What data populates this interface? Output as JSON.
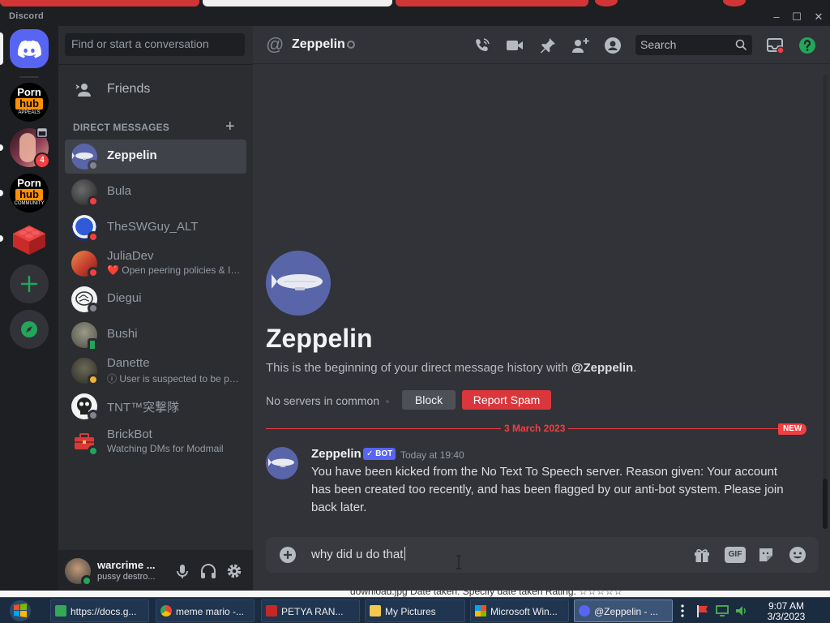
{
  "app": {
    "title": "Discord"
  },
  "window_controls": {
    "minimize": "–",
    "maximize": "☐",
    "close": "✕"
  },
  "servers": [
    {
      "name": "pornhub appeals",
      "logo_top": "Porn",
      "logo_bottom": "hub",
      "logo_sub": "APPEALS"
    },
    {
      "name": "server with notifications",
      "badge": "4"
    },
    {
      "name": "pornhub community",
      "logo_top": "Porn",
      "logo_bottom": "hub",
      "logo_sub": "COMMUNITY"
    },
    {
      "name": "lego server"
    }
  ],
  "sidebar": {
    "search_placeholder": "Find or start a conversation",
    "friends_label": "Friends",
    "dm_header": "DIRECT MESSAGES",
    "dm_add": "+",
    "dms": [
      {
        "name": "Zeppelin",
        "status": "offline",
        "active": true
      },
      {
        "name": "Bula",
        "status": "dnd"
      },
      {
        "name": "TheSWGuy_ALT",
        "status": "dnd"
      },
      {
        "name": "JuliaDev",
        "status": "dnd",
        "sub": "❤️ Open peering policies & IP..."
      },
      {
        "name": "Diegui",
        "status": "offline"
      },
      {
        "name": "Bushi",
        "status": "mobile"
      },
      {
        "name": "Danette",
        "status": "idle",
        "sub": "ⓘ User is suspected to be par..."
      },
      {
        "name": "TNT™突撃隊",
        "status": "offline"
      },
      {
        "name": "BrickBot",
        "status": "online",
        "sub": "Watching DMs for Modmail"
      }
    ]
  },
  "user_panel": {
    "name": "warcrime ...",
    "status": "pussy destro..."
  },
  "header": {
    "at": "@",
    "title": "Zeppelin",
    "search_placeholder": "Search"
  },
  "intro": {
    "name": "Zeppelin",
    "text_prefix": "This is the beginning of your direct message history with ",
    "text_handle": "@Zeppelin",
    "text_suffix": ".",
    "no_servers": "No servers in common",
    "block_label": "Block",
    "report_label": "Report Spam"
  },
  "divider": {
    "date": "3 March 2023",
    "new_label": "NEW"
  },
  "message": {
    "author": "Zeppelin",
    "bot_tag": "✓ BOT",
    "time": "Today at 19:40",
    "text": "You have been kicked from the No Text To Speech server. Reason given: Your account has been created too recently, and has been flagged by our anti-bot system. Please join back later."
  },
  "composer": {
    "value": "why did u do that",
    "gif_label": "GIF"
  },
  "behind_window": {
    "text": "download.jpg  Date taken: Specify date taken         Rating: ☆☆☆☆☆"
  },
  "taskbar": {
    "items": [
      {
        "label": "https://docs.g...",
        "color": "#34a853"
      },
      {
        "label": "meme mario -...",
        "color": "#ea4335"
      },
      {
        "label": "PETYA RAN...",
        "color": "#c62828"
      },
      {
        "label": "My Pictures",
        "color": "#f2c94c"
      },
      {
        "label": "Microsoft Win...",
        "color": "#e8a33d"
      },
      {
        "label": "@Zeppelin - ...",
        "color": "#5865f2",
        "active": true
      }
    ],
    "time": "9:07 AM",
    "date": "3/3/2023"
  },
  "colors": {
    "accent": "#5865f2",
    "danger": "#f23f43",
    "online": "#23a55a",
    "idle": "#f0b232"
  }
}
